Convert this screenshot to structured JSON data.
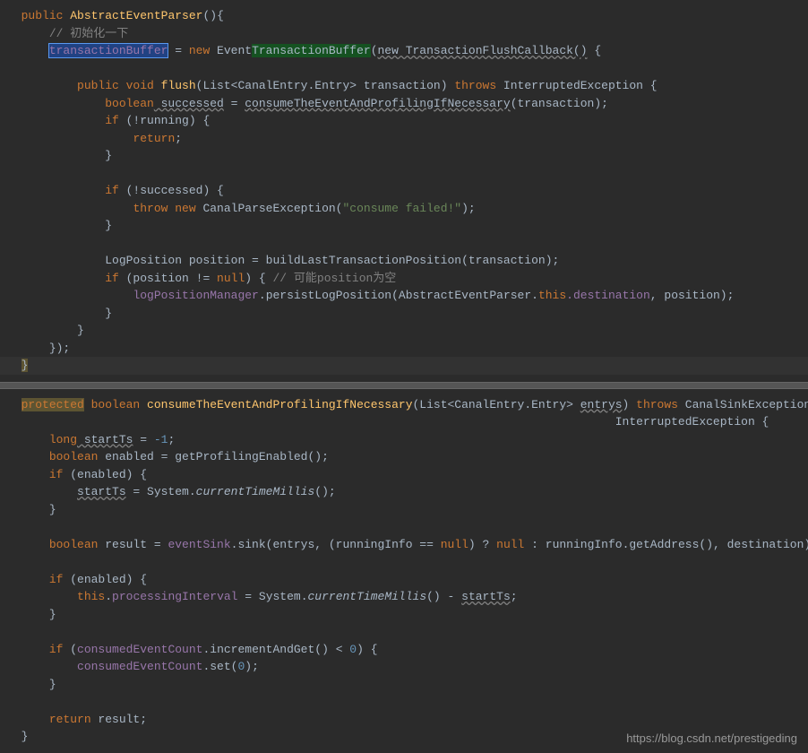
{
  "block1": {
    "l1_public": "public",
    "l1_method": "AbstractEventParser",
    "l1_parens": "()",
    "l1_brace": "{",
    "l2_comment": "// 初始化一下",
    "l3_field": "transactionBuffer",
    "l3_eq": " = ",
    "l3_new": "new",
    "l3_type1": " Event",
    "l3_type2": "TransactionBuffer",
    "l3_paren": "(",
    "l3_inner": "new TransactionFlushCallback()",
    "l3_brace": " {",
    "l5_public": "public",
    "l5_void": " void",
    "l5_method": " flush",
    "l5_sig": "(List<CanalEntry.Entry> transaction) ",
    "l5_throws": "throws",
    "l5_exc": " InterruptedException {",
    "l6_boolean": "boolean",
    "l6_var": " successed",
    "l6_eq": " = ",
    "l6_call": "consumeTheEventAndProfilingIfNecessary",
    "l6_args": "(transaction);",
    "l7_if": "if",
    "l7_cond": " (!running) {",
    "l8_return": "return",
    "l8_semi": ";",
    "l9_close": "}",
    "l11_if": "if",
    "l11_cond": " (!successed) {",
    "l12_throw": "throw new",
    "l12_type": " CanalParseException(",
    "l12_str": "\"consume failed!\"",
    "l12_end": ");",
    "l13_close": "}",
    "l15_call": "LogPosition position = buildLastTransactionPosition(transaction);",
    "l16_if": "if",
    "l16_cond": " (position != ",
    "l16_null": "null",
    "l16_rest": ") { ",
    "l16_comment": "// 可能position为空",
    "l17_field": "logPositionManager",
    "l17_dot": ".",
    "l17_method": "persistLogPosition",
    "l17_args1": "(AbstractEventParser.",
    "l17_this": "this",
    "l17_dest": ".destination",
    "l17_pos": ", position);",
    "l18_close": "}",
    "l19_close": "}",
    "l20_close": "});",
    "l21_close": "}"
  },
  "block2": {
    "l1_protected": "protected",
    "l1_boolean": " boolean",
    "l1_method": " consumeTheEventAndProfilingIfNecessary",
    "l1_sig1": "(List<CanalEntry.Entry> ",
    "l1_param": "entrys",
    "l1_sig2": ") ",
    "l1_throws": "throws",
    "l1_exc1": " CanalSinkException,",
    "l2_exc2": "InterruptedException {",
    "l3_long": "long",
    "l3_var": " startTs",
    "l3_eq": " = ",
    "l3_neg": "-1",
    "l3_semi": ";",
    "l4_boolean": "boolean",
    "l4_rest": " enabled = getProfilingEnabled();",
    "l5_if": "if",
    "l5_cond": " (enabled) {",
    "l6_var": "startTs",
    "l6_eq": " = System.",
    "l6_method": "currentTimeMillis",
    "l6_end": "();",
    "l7_close": "}",
    "l9_boolean": "boolean",
    "l9_rest1": " result = ",
    "l9_field": "eventSink",
    "l9_rest2": ".sink(entrys, (runningInfo == ",
    "l9_null1": "null",
    "l9_rest3": ") ? ",
    "l9_null2": "null",
    "l9_rest4": " : runningInfo.getAddress(), destination);",
    "l11_if": "if",
    "l11_cond": " (enabled) {",
    "l12_this": "this",
    "l12_dot": ".",
    "l12_field": "processingInterval",
    "l12_eq": " = System.",
    "l12_method": "currentTimeMillis",
    "l12_rest": "() - ",
    "l12_var": "startTs",
    "l12_semi": ";",
    "l13_close": "}",
    "l15_if": "if",
    "l15_cond1": " (",
    "l15_field": "consumedEventCount",
    "l15_cond2": ".incrementAndGet() < ",
    "l15_zero": "0",
    "l15_cond3": ") {",
    "l16_field": "consumedEventCount",
    "l16_rest": ".set(",
    "l16_zero": "0",
    "l16_end": ");",
    "l17_close": "}",
    "l19_return": "return",
    "l19_rest": " result;",
    "l20_close": "}"
  },
  "watermark": "https://blog.csdn.net/prestigeding"
}
